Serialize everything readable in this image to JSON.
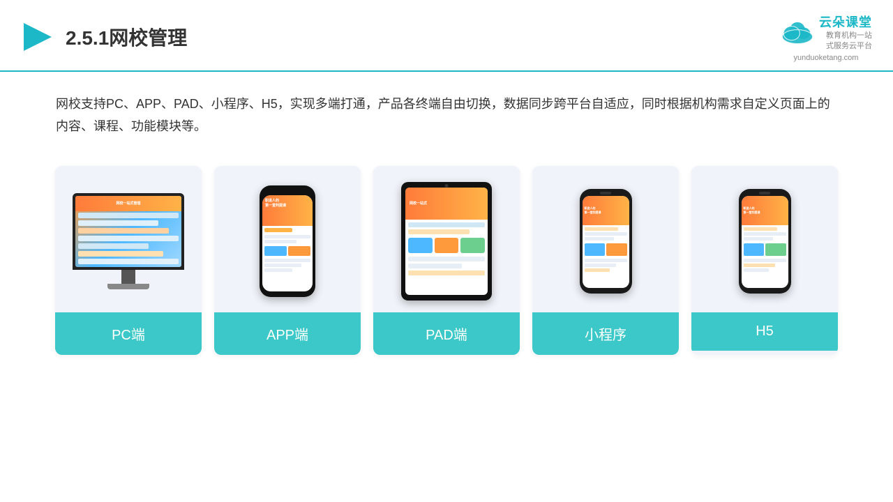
{
  "header": {
    "title": "2.5.1网校管理",
    "logo_name": "云朵课堂",
    "logo_url": "yunduoketang.com",
    "logo_slogan": "教育机构一站\n式服务云平台"
  },
  "description": "网校支持PC、APP、PAD、小程序、H5，实现多端打通，产品各终端自由切换，数据同步跨平台自适应，同时根据机构需求自定义页面上的内容、课程、功能模块等。",
  "cards": [
    {
      "id": "pc",
      "label": "PC端"
    },
    {
      "id": "app",
      "label": "APP端"
    },
    {
      "id": "pad",
      "label": "PAD端"
    },
    {
      "id": "miniprogram",
      "label": "小程序"
    },
    {
      "id": "h5",
      "label": "H5"
    }
  ],
  "accent_color": "#3cc8c8"
}
